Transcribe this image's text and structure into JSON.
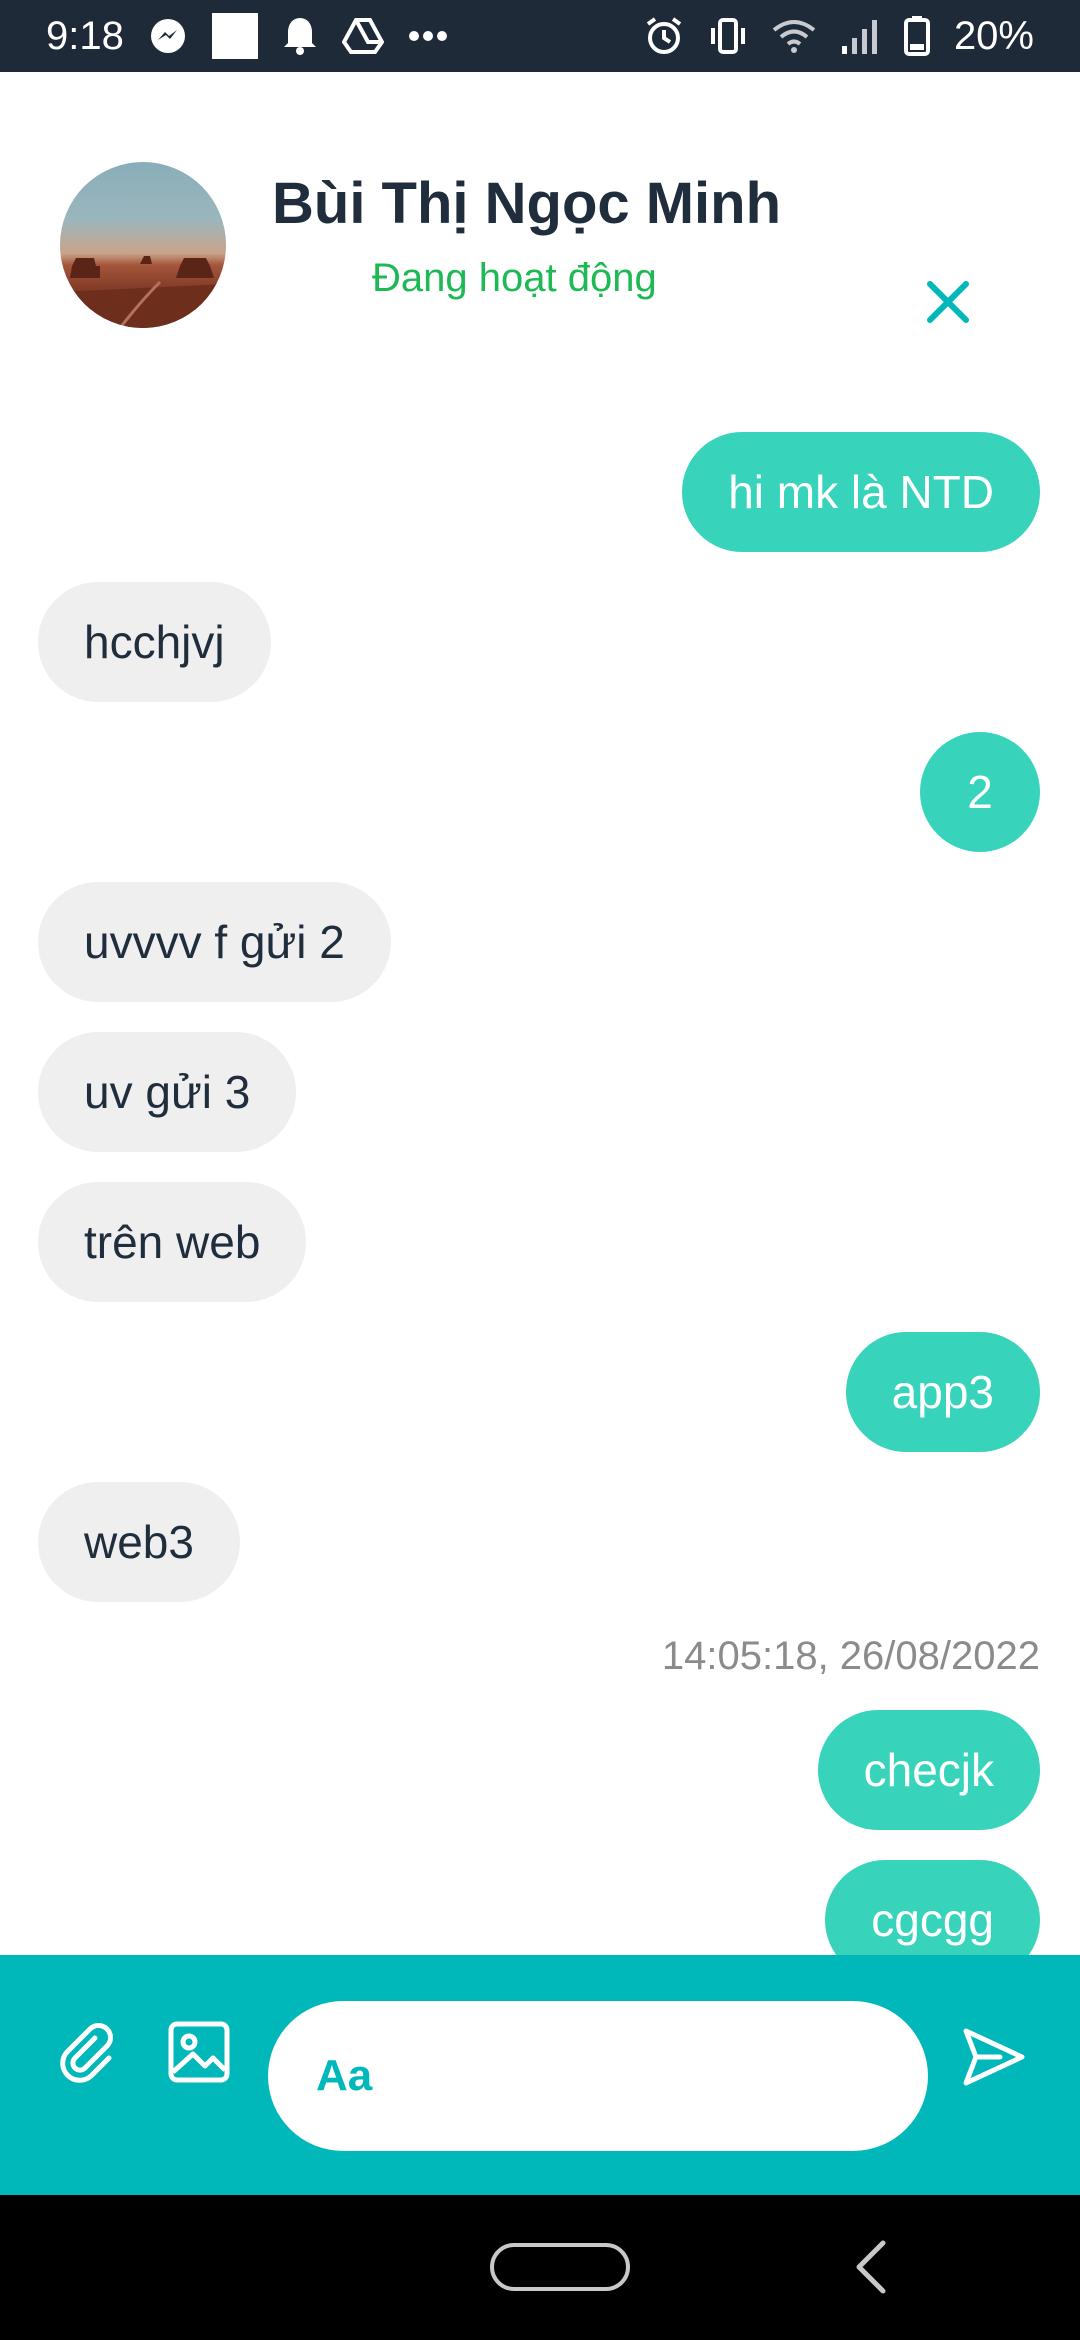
{
  "status_bar": {
    "time": "9:18",
    "battery": "20%",
    "icons": [
      "messenger-icon",
      "square-icon",
      "bell-icon",
      "drive-icon",
      "more-dots-icon",
      "alarm-icon",
      "vibrate-icon",
      "wifi-icon",
      "signal-icon",
      "battery-icon"
    ]
  },
  "header": {
    "name": "Bùi Thị Ngọc Minh",
    "status": "Đang hoạt động",
    "status_color": "#1db954",
    "accent_color": "#00b7b9"
  },
  "messages": [
    {
      "direction": "out",
      "text": "hi  mk là NTD"
    },
    {
      "direction": "in",
      "text": "hcchjvj"
    },
    {
      "direction": "out",
      "text": "2"
    },
    {
      "direction": "in",
      "text": "uvvvv f gửi 2"
    },
    {
      "direction": "in",
      "text": "uv gửi 3"
    },
    {
      "direction": "in",
      "text": "trên web"
    },
    {
      "direction": "out",
      "text": "app3"
    },
    {
      "direction": "in",
      "text": "web3"
    },
    {
      "direction": "out",
      "text": "checjk"
    },
    {
      "direction": "out",
      "text": "cgcgg"
    }
  ],
  "timestamp": "14:05:18, 26/08/2022",
  "composer": {
    "placeholder": "Aa",
    "value": "",
    "icons": [
      "paperclip-icon",
      "image-icon",
      "send-icon"
    ]
  },
  "colors": {
    "outgoing_bubble": "#38d3bb",
    "incoming_bubble": "#efefef",
    "composer_bg": "#00b7b9",
    "status_bar_bg": "#1f2a38"
  }
}
